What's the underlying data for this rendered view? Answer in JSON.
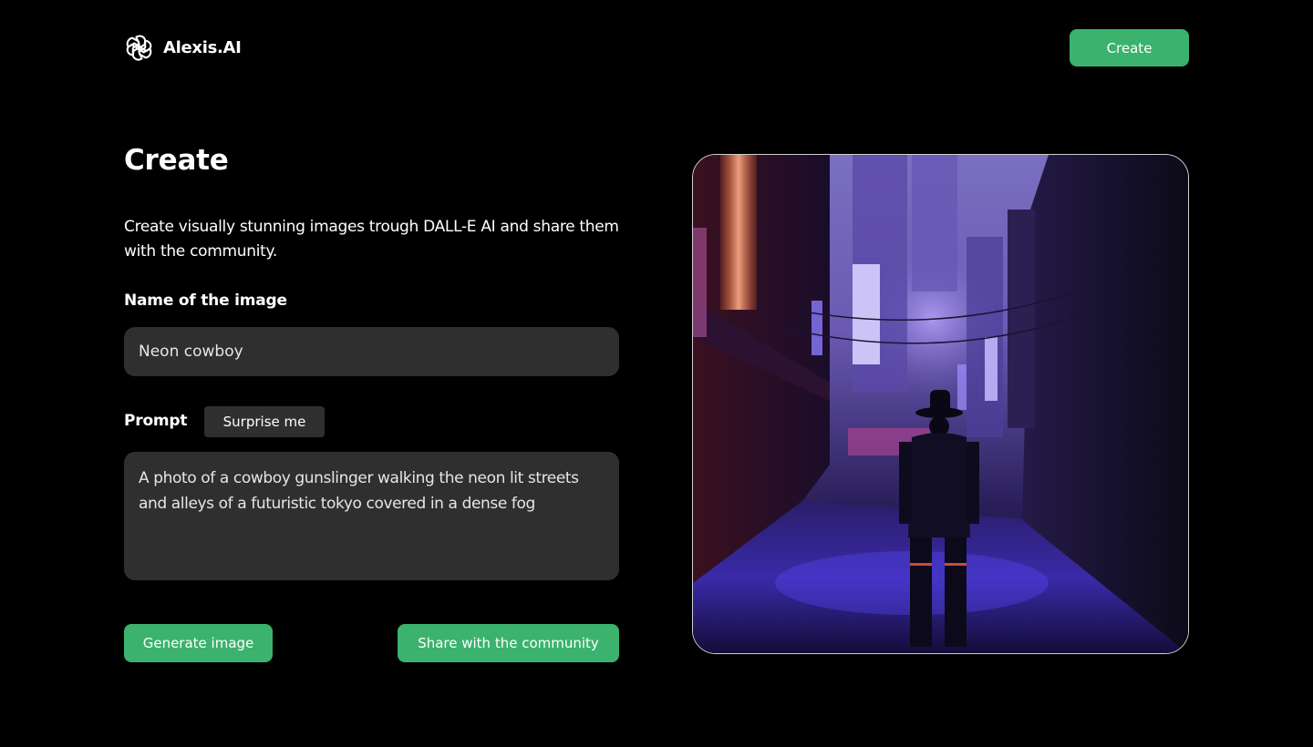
{
  "header": {
    "brand": "Alexis.AI",
    "logo_icon": "openai-knot-icon",
    "create_label": "Create"
  },
  "main": {
    "title": "Create",
    "subtitle": "Create visually stunning images trough DALL-E AI and share them with the community.",
    "name_label": "Name of the image",
    "name_value": "Neon cowboy",
    "prompt_label": "Prompt",
    "surprise_label": "Surprise me",
    "prompt_value": "A photo of a cowboy gunslinger walking the neon lit streets and alleys of a futuristic tokyo covered in a dense fog",
    "generate_label": "Generate image",
    "share_label": "Share with the community"
  },
  "preview": {
    "image_description_icon": "generated-image"
  },
  "colors": {
    "background": "#000000",
    "accent": "#3bb26d",
    "field": "#2f2f2f"
  }
}
